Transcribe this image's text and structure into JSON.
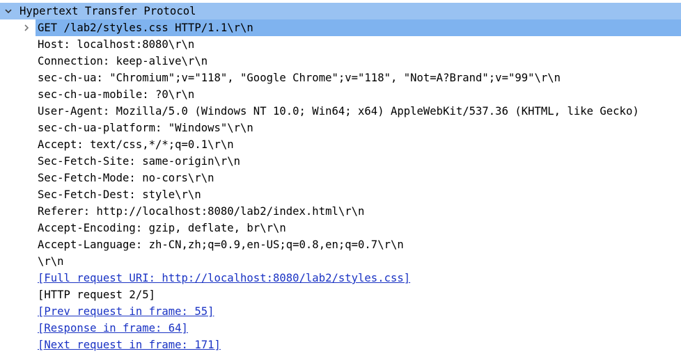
{
  "tree": {
    "section": {
      "label": "Hypertext Transfer Protocol",
      "expanded": true
    },
    "request_line": {
      "label": "GET /lab2/styles.css HTTP/1.1\\r\\n",
      "expanded": false,
      "selected": true
    },
    "headers": [
      "Host: localhost:8080\\r\\n",
      "Connection: keep-alive\\r\\n",
      "sec-ch-ua: \"Chromium\";v=\"118\", \"Google Chrome\";v=\"118\", \"Not=A?Brand\";v=\"99\"\\r\\n",
      "sec-ch-ua-mobile: ?0\\r\\n",
      "User-Agent: Mozilla/5.0 (Windows NT 10.0; Win64; x64) AppleWebKit/537.36 (KHTML, like Gecko)",
      "sec-ch-ua-platform: \"Windows\"\\r\\n",
      "Accept: text/css,*/*;q=0.1\\r\\n",
      "Sec-Fetch-Site: same-origin\\r\\n",
      "Sec-Fetch-Mode: no-cors\\r\\n",
      "Sec-Fetch-Dest: style\\r\\n",
      "Referer: http://localhost:8080/lab2/index.html\\r\\n",
      "Accept-Encoding: gzip, deflate, br\\r\\n",
      "Accept-Language: zh-CN,zh;q=0.9,en-US;q=0.8,en;q=0.7\\r\\n",
      "\\r\\n"
    ],
    "full_request_uri": "[Full request URI: http://localhost:8080/lab2/styles.css]",
    "http_request_number": "[HTTP request 2/5]",
    "prev_request": "[Prev request in frame: 55]",
    "response_frame": "[Response in frame: 64]",
    "next_request": "[Next request in frame: 171]"
  },
  "colors": {
    "section_bg": "#99c2f2",
    "selected_bg": "#7fb3ef",
    "link": "#1a33c4",
    "text": "#000000"
  },
  "icons": {
    "section_toggle": "chevron-down-icon",
    "request_line_toggle": "chevron-right-icon"
  }
}
